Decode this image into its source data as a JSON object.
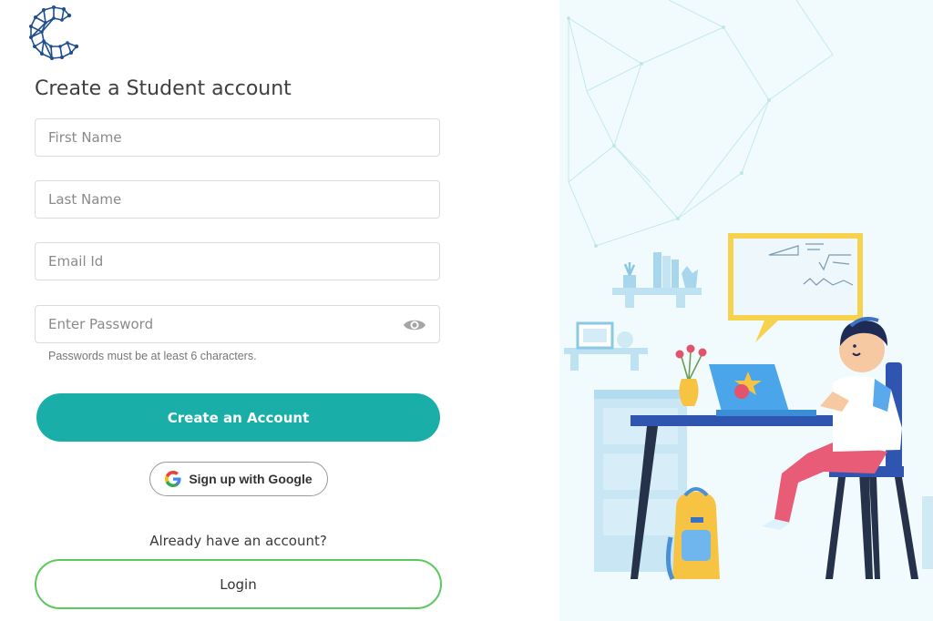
{
  "form": {
    "title": "Create a Student account",
    "first_name_placeholder": "First Name",
    "last_name_placeholder": "Last Name",
    "email_placeholder": "Email Id",
    "password_placeholder": "Enter Password",
    "password_hint": "Passwords must be at least 6 characters.",
    "create_button": "Create an Account",
    "google_button": "Sign up with Google",
    "login_prompt": "Already have an account?",
    "login_button": "Login"
  },
  "icons": {
    "logo": "brand-logo-icon",
    "password_toggle": "eye-icon",
    "google": "google-icon"
  },
  "colors": {
    "primary": "#1aaea8",
    "login_border": "#5cc95c",
    "illustration_bg": "#f1fbfd"
  }
}
